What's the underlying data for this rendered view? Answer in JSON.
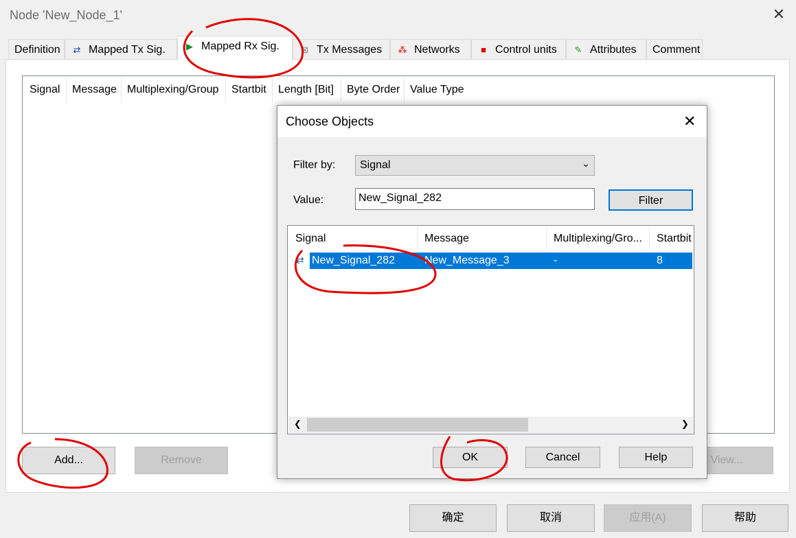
{
  "window": {
    "title": "Node 'New_Node_1'"
  },
  "tabs": [
    {
      "label": "Definition",
      "icon": ""
    },
    {
      "label": "Mapped Tx Sig.",
      "icon": "mapped-tx-icon"
    },
    {
      "label": "Mapped Rx Sig.",
      "icon": "mapped-rx-icon",
      "active": true
    },
    {
      "label": "Tx Messages",
      "icon": "message-icon"
    },
    {
      "label": "Networks",
      "icon": "network-icon"
    },
    {
      "label": "Control units",
      "icon": "control-unit-icon"
    },
    {
      "label": "Attributes",
      "icon": "attributes-icon"
    },
    {
      "label": "Comment",
      "icon": ""
    }
  ],
  "list": {
    "columns": [
      "Signal",
      "Message",
      "Multiplexing/Group",
      "Startbit",
      "Length [Bit]",
      "Byte Order",
      "Value Type"
    ]
  },
  "buttons": {
    "add": "Add...",
    "remove": "Remove",
    "view": "View..."
  },
  "footer": {
    "ok": "确定",
    "cancel": "取消",
    "apply": "应用(A)",
    "help": "帮助"
  },
  "dialog": {
    "title": "Choose Objects",
    "filter_by_label": "Filter by:",
    "filter_by_value": "Signal",
    "value_label": "Value:",
    "value": "New_Signal_282",
    "filter_button": "Filter",
    "columns": [
      "Signal",
      "Message",
      "Multiplexing/Gro...",
      "Startbit"
    ],
    "rows": [
      {
        "signal": "New_Signal_282",
        "message": "New_Message_3",
        "multiplexing": "-",
        "startbit": "8",
        "selected": true
      }
    ],
    "ok": "OK",
    "cancel": "Cancel",
    "help": "Help"
  },
  "colors": {
    "selection": "#0078d7",
    "annotation": "#e00000"
  }
}
